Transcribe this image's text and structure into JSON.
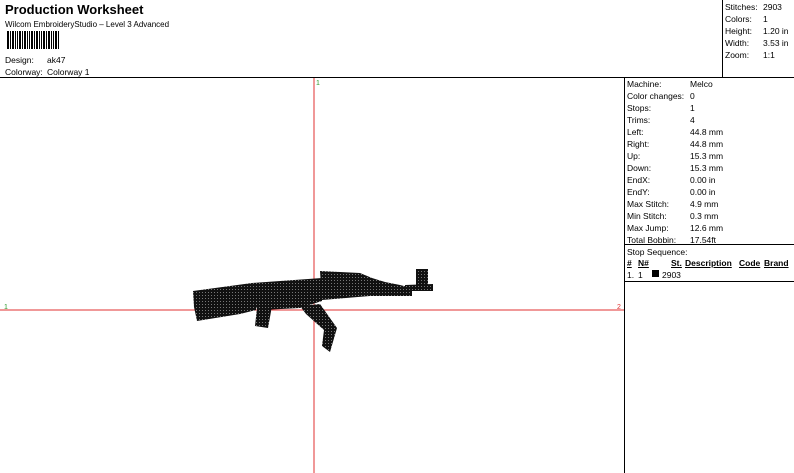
{
  "header": {
    "title": "Production Worksheet",
    "subtitle": "Wilcom EmbroideryStudio – Level 3 Advanced",
    "design_label": "Design:",
    "design_value": "ak47",
    "colorway_label": "Colorway:",
    "colorway_value": "Colorway 1"
  },
  "summary": [
    {
      "label": "Stitches:",
      "value": "2903"
    },
    {
      "label": "Colors:",
      "value": "1"
    },
    {
      "label": "Height:",
      "value": "1.20 in"
    },
    {
      "label": "Width:",
      "value": "3.53 in"
    },
    {
      "label": "Zoom:",
      "value": "1:1"
    }
  ],
  "machine_info": [
    {
      "label": "Machine:",
      "value": "Melco"
    },
    {
      "label": "Color changes:",
      "value": "0"
    },
    {
      "label": "Stops:",
      "value": "1"
    },
    {
      "label": "Trims:",
      "value": "4"
    },
    {
      "label": "Left:",
      "value": "44.8 mm"
    },
    {
      "label": "Right:",
      "value": "44.8 mm"
    },
    {
      "label": "Up:",
      "value": "15.3 mm"
    },
    {
      "label": "Down:",
      "value": "15.3 mm"
    },
    {
      "label": "EndX:",
      "value": "0.00 in"
    },
    {
      "label": "EndY:",
      "value": "0.00 in"
    },
    {
      "label": "Max Stitch:",
      "value": "4.9 mm"
    },
    {
      "label": "Min Stitch:",
      "value": "0.3 mm"
    },
    {
      "label": "Max Jump:",
      "value": "12.6 mm"
    },
    {
      "label": "Total Bobbin:",
      "value": "17.54ft"
    }
  ],
  "stop_sequence": {
    "title": "Stop Sequence:",
    "columns": [
      "#",
      "N#",
      "St.",
      "Description",
      "Code",
      "Brand"
    ],
    "rows": [
      {
        "index": "1.",
        "needle": "1",
        "stitches": "2903",
        "swatch_color": "#000000"
      }
    ]
  },
  "canvas": {
    "axis_color": "#e03030",
    "top_marker": "1",
    "left_marker": "1",
    "right_marker": "2",
    "design_color": "#000000"
  }
}
